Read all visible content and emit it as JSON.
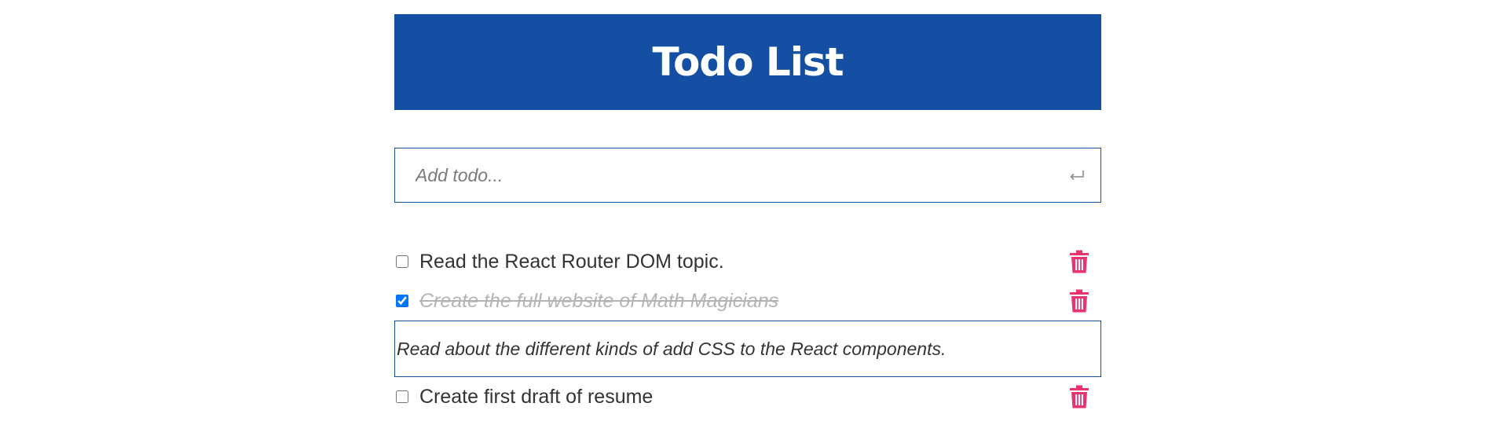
{
  "header": {
    "title": "Todo List"
  },
  "add_form": {
    "placeholder": "Add todo...",
    "submit_icon": "enter-return-icon"
  },
  "todos": [
    {
      "label": "Read the React Router DOM topic.",
      "completed": false
    },
    {
      "label": "Create the full website of Math Magicians",
      "completed": true
    },
    {
      "label": "Read about the different kinds of add CSS to the React components.",
      "editing": true
    },
    {
      "label": "Create first draft of resume",
      "completed": false
    }
  ],
  "icons": {
    "delete": "trash-icon"
  },
  "colors": {
    "brand": "#154fa3",
    "delete": "#e8336d",
    "completed_text": "#b4b4b4"
  }
}
